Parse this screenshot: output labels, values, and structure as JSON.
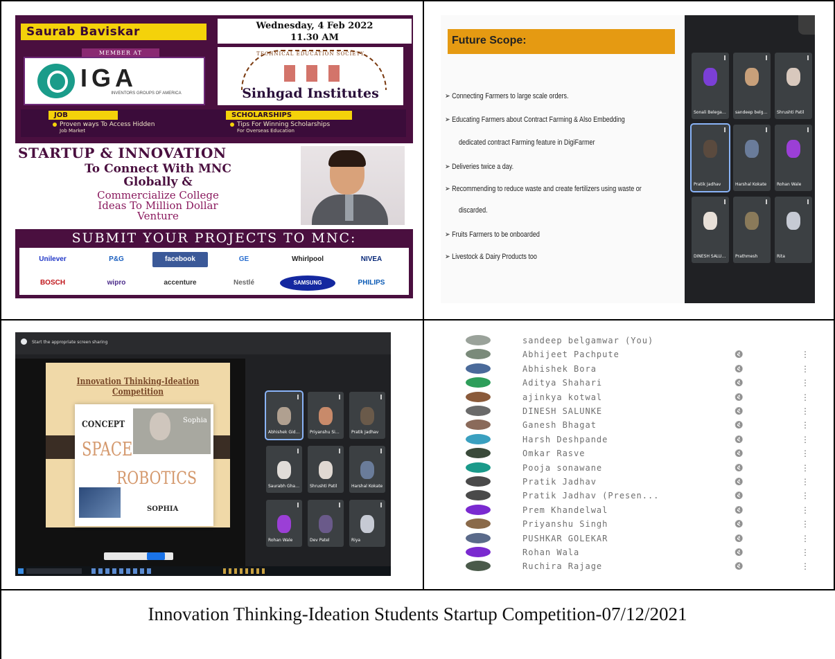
{
  "poster": {
    "name": "Saurab Baviskar",
    "date_line1": "Wednesday, 4 Feb 2022",
    "date_line2": "11.30 AM",
    "member_tag": "MEMBER AT",
    "iga_logo_text": "IGA",
    "iga_logo_sub": "INVENTORS GROUPS OF AMERICA",
    "sinhgad_arc_text": "TECHNICAL EDUCATION SOCIETY",
    "sinhgad_label": "Sinhgad Institutes",
    "job_tag": "JOB",
    "job_text_1": "Proven ways To Access Hidden",
    "job_text_2": "Job Market",
    "scholarships_tag": "SCHOLARSHIPS",
    "scholarships_text_1": "Tips For Winning Scholarships",
    "scholarships_text_2": "For Overseas Education",
    "startup_heading": "STARTUP & INNOVATION",
    "mnc_line1": "To Connect With MNC",
    "mnc_line2": "Globally &",
    "comm_line1": "Commercialize College",
    "comm_line2": "Ideas To Million Dollar",
    "comm_line3": "Venture",
    "submit_line": "SUBMIT YOUR PROJECTS TO MNC:",
    "logos": [
      {
        "label": "Unilever",
        "color": "#1f36c7"
      },
      {
        "label": "P&G",
        "color": "#1a5fbf"
      },
      {
        "label": "facebook",
        "color": "#3b5998"
      },
      {
        "label": "GE",
        "color": "#2a6fd0"
      },
      {
        "label": "Whirlpool",
        "color": "#222222"
      },
      {
        "label": "NIVEA",
        "color": "#0a2a7a"
      },
      {
        "label": "BOSCH",
        "color": "#c0161b"
      },
      {
        "label": "wipro",
        "color": "#4a2a8a"
      },
      {
        "label": "accenture",
        "color": "#333333"
      },
      {
        "label": "Nestlé",
        "color": "#666666"
      },
      {
        "label": "SAMSUNG",
        "color": "#1428a0"
      },
      {
        "label": "PHILIPS",
        "color": "#0a5ab5"
      }
    ]
  },
  "meet2": {
    "slide_title": "Future Scope:",
    "lines": [
      "➢ Connecting Farmers to large scale orders.",
      "➢ Educating Farmers about Contract Farming & Also Embedding",
      "dedicated contract Farming feature in DigiFarmer",
      "➢ Deliveries twice a day.",
      "➢ Recommending to reduce waste and create fertilizers using waste or",
      "discarded.",
      "➢ Fruits Farmers to be onboarded",
      "➢ Livestock & Dairy Products too"
    ],
    "tiles": [
      {
        "name": "Sonali Belegaonkar",
        "avatar": "#7b3fd6"
      },
      {
        "name": "sandeep belgamwar",
        "avatar": "#c8a07a"
      },
      {
        "name": "Shrushti Patil",
        "avatar": "#d8c8bd"
      },
      {
        "name": "Pratik Jadhav",
        "avatar": "#5a4a3e"
      },
      {
        "name": "Harshal Kokate",
        "avatar": "#6a7c9a"
      },
      {
        "name": "Rohan Wale",
        "avatar": "#9b3fd6"
      },
      {
        "name": "DINESH SALUNKE",
        "avatar": "#e8e0d8"
      },
      {
        "name": "Prathmesh",
        "avatar": "#8a7a5a"
      },
      {
        "name": "Rita",
        "avatar": "#c6cad4"
      }
    ]
  },
  "meet3": {
    "bar_title": "Start the appropriate screen sharing",
    "slide_title": "Innovation Thinking-Ideation Competition",
    "concept": "CONCEPT",
    "space": "SPACE",
    "robotics": "ROBOTICS",
    "sophia_small": "SOPHIA",
    "sophia_label": "Sophia",
    "tiles": [
      {
        "name": "Abhishek Gidhadhe",
        "avatar": "#b0a090"
      },
      {
        "name": "Priyanshu Singh",
        "avatar": "#c88a6a"
      },
      {
        "name": "Pratik Jadhav",
        "avatar": "#6a5a4a"
      },
      {
        "name": "Saurabh Ghawale",
        "avatar": "#e0dcd8"
      },
      {
        "name": "Shrushti Patil",
        "avatar": "#e0d8d2"
      },
      {
        "name": "Harshal Kokate",
        "avatar": "#6a7c9a"
      },
      {
        "name": "Rohan Wale",
        "avatar": "#9b3fd6"
      },
      {
        "name": "Dev Patel",
        "avatar": "#6a5a8a"
      },
      {
        "name": "Riya",
        "avatar": "#c6cad4"
      }
    ]
  },
  "participants": [
    {
      "name": "sandeep belgamwar (You)",
      "color": "#9aa29a"
    },
    {
      "name": "Abhijeet Pachpute",
      "color": "#7a8a7a"
    },
    {
      "name": "Abhishek Bora",
      "color": "#4a6a9a"
    },
    {
      "name": "Aditya Shahari",
      "color": "#2e9e5a"
    },
    {
      "name": "ajinkya kotwal",
      "color": "#8a5a3a"
    },
    {
      "name": "DINESH SALUNKE",
      "color": "#6a6a6a"
    },
    {
      "name": "Ganesh Bhagat",
      "color": "#8a6a5a"
    },
    {
      "name": "Harsh Deshpande",
      "color": "#3aa0c0"
    },
    {
      "name": "Omkar Rasve",
      "color": "#3a4a3a"
    },
    {
      "name": "Pooja sonawane",
      "color": "#1a9a8a"
    },
    {
      "name": "Pratik Jadhav",
      "color": "#4a4a4a"
    },
    {
      "name": "Pratik Jadhav (Presen...",
      "color": "#4a4a4a"
    },
    {
      "name": "Prem Khandelwal",
      "color": "#7a2ad0"
    },
    {
      "name": "Priyanshu Singh",
      "color": "#8a6a4a"
    },
    {
      "name": "PUSHKAR GOLEKAR",
      "color": "#5a6a8a"
    },
    {
      "name": "Rohan Wala",
      "color": "#7a2ad0"
    },
    {
      "name": "Ruchira Rajage",
      "color": "#4a5a4a"
    }
  ],
  "caption": "Innovation Thinking-Ideation Students Startup Competition-07/12/2021"
}
